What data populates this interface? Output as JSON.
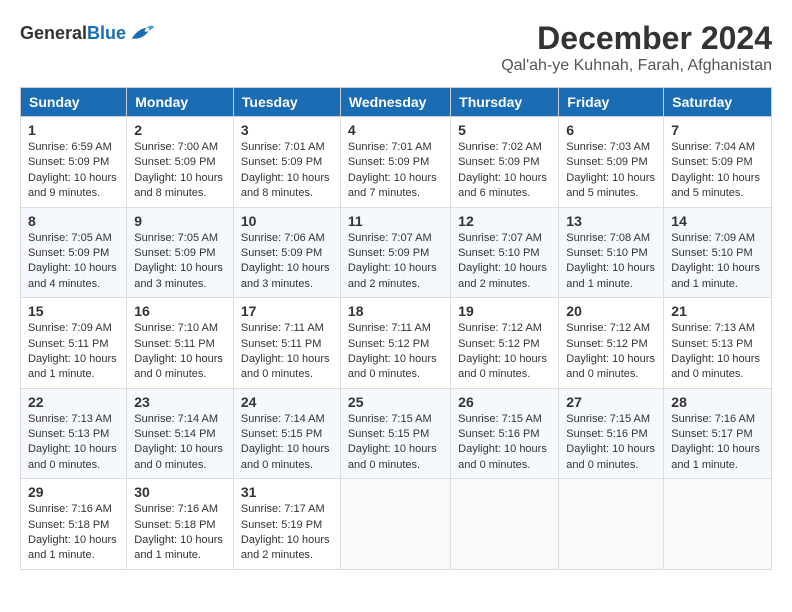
{
  "header": {
    "logo_line1": "General",
    "logo_line2": "Blue",
    "title": "December 2024",
    "subtitle": "Qal'ah-ye Kuhnah, Farah, Afghanistan"
  },
  "calendar": {
    "days_of_week": [
      "Sunday",
      "Monday",
      "Tuesday",
      "Wednesday",
      "Thursday",
      "Friday",
      "Saturday"
    ],
    "weeks": [
      [
        {
          "day": "1",
          "info": "Sunrise: 6:59 AM\nSunset: 5:09 PM\nDaylight: 10 hours\nand 9 minutes."
        },
        {
          "day": "2",
          "info": "Sunrise: 7:00 AM\nSunset: 5:09 PM\nDaylight: 10 hours\nand 8 minutes."
        },
        {
          "day": "3",
          "info": "Sunrise: 7:01 AM\nSunset: 5:09 PM\nDaylight: 10 hours\nand 8 minutes."
        },
        {
          "day": "4",
          "info": "Sunrise: 7:01 AM\nSunset: 5:09 PM\nDaylight: 10 hours\nand 7 minutes."
        },
        {
          "day": "5",
          "info": "Sunrise: 7:02 AM\nSunset: 5:09 PM\nDaylight: 10 hours\nand 6 minutes."
        },
        {
          "day": "6",
          "info": "Sunrise: 7:03 AM\nSunset: 5:09 PM\nDaylight: 10 hours\nand 5 minutes."
        },
        {
          "day": "7",
          "info": "Sunrise: 7:04 AM\nSunset: 5:09 PM\nDaylight: 10 hours\nand 5 minutes."
        }
      ],
      [
        {
          "day": "8",
          "info": "Sunrise: 7:05 AM\nSunset: 5:09 PM\nDaylight: 10 hours\nand 4 minutes."
        },
        {
          "day": "9",
          "info": "Sunrise: 7:05 AM\nSunset: 5:09 PM\nDaylight: 10 hours\nand 3 minutes."
        },
        {
          "day": "10",
          "info": "Sunrise: 7:06 AM\nSunset: 5:09 PM\nDaylight: 10 hours\nand 3 minutes."
        },
        {
          "day": "11",
          "info": "Sunrise: 7:07 AM\nSunset: 5:09 PM\nDaylight: 10 hours\nand 2 minutes."
        },
        {
          "day": "12",
          "info": "Sunrise: 7:07 AM\nSunset: 5:10 PM\nDaylight: 10 hours\nand 2 minutes."
        },
        {
          "day": "13",
          "info": "Sunrise: 7:08 AM\nSunset: 5:10 PM\nDaylight: 10 hours\nand 1 minute."
        },
        {
          "day": "14",
          "info": "Sunrise: 7:09 AM\nSunset: 5:10 PM\nDaylight: 10 hours\nand 1 minute."
        }
      ],
      [
        {
          "day": "15",
          "info": "Sunrise: 7:09 AM\nSunset: 5:11 PM\nDaylight: 10 hours\nand 1 minute."
        },
        {
          "day": "16",
          "info": "Sunrise: 7:10 AM\nSunset: 5:11 PM\nDaylight: 10 hours\nand 0 minutes."
        },
        {
          "day": "17",
          "info": "Sunrise: 7:11 AM\nSunset: 5:11 PM\nDaylight: 10 hours\nand 0 minutes."
        },
        {
          "day": "18",
          "info": "Sunrise: 7:11 AM\nSunset: 5:12 PM\nDaylight: 10 hours\nand 0 minutes."
        },
        {
          "day": "19",
          "info": "Sunrise: 7:12 AM\nSunset: 5:12 PM\nDaylight: 10 hours\nand 0 minutes."
        },
        {
          "day": "20",
          "info": "Sunrise: 7:12 AM\nSunset: 5:12 PM\nDaylight: 10 hours\nand 0 minutes."
        },
        {
          "day": "21",
          "info": "Sunrise: 7:13 AM\nSunset: 5:13 PM\nDaylight: 10 hours\nand 0 minutes."
        }
      ],
      [
        {
          "day": "22",
          "info": "Sunrise: 7:13 AM\nSunset: 5:13 PM\nDaylight: 10 hours\nand 0 minutes."
        },
        {
          "day": "23",
          "info": "Sunrise: 7:14 AM\nSunset: 5:14 PM\nDaylight: 10 hours\nand 0 minutes."
        },
        {
          "day": "24",
          "info": "Sunrise: 7:14 AM\nSunset: 5:15 PM\nDaylight: 10 hours\nand 0 minutes."
        },
        {
          "day": "25",
          "info": "Sunrise: 7:15 AM\nSunset: 5:15 PM\nDaylight: 10 hours\nand 0 minutes."
        },
        {
          "day": "26",
          "info": "Sunrise: 7:15 AM\nSunset: 5:16 PM\nDaylight: 10 hours\nand 0 minutes."
        },
        {
          "day": "27",
          "info": "Sunrise: 7:15 AM\nSunset: 5:16 PM\nDaylight: 10 hours\nand 0 minutes."
        },
        {
          "day": "28",
          "info": "Sunrise: 7:16 AM\nSunset: 5:17 PM\nDaylight: 10 hours\nand 1 minute."
        }
      ],
      [
        {
          "day": "29",
          "info": "Sunrise: 7:16 AM\nSunset: 5:18 PM\nDaylight: 10 hours\nand 1 minute."
        },
        {
          "day": "30",
          "info": "Sunrise: 7:16 AM\nSunset: 5:18 PM\nDaylight: 10 hours\nand 1 minute."
        },
        {
          "day": "31",
          "info": "Sunrise: 7:17 AM\nSunset: 5:19 PM\nDaylight: 10 hours\nand 2 minutes."
        },
        {
          "day": "",
          "info": ""
        },
        {
          "day": "",
          "info": ""
        },
        {
          "day": "",
          "info": ""
        },
        {
          "day": "",
          "info": ""
        }
      ]
    ]
  }
}
